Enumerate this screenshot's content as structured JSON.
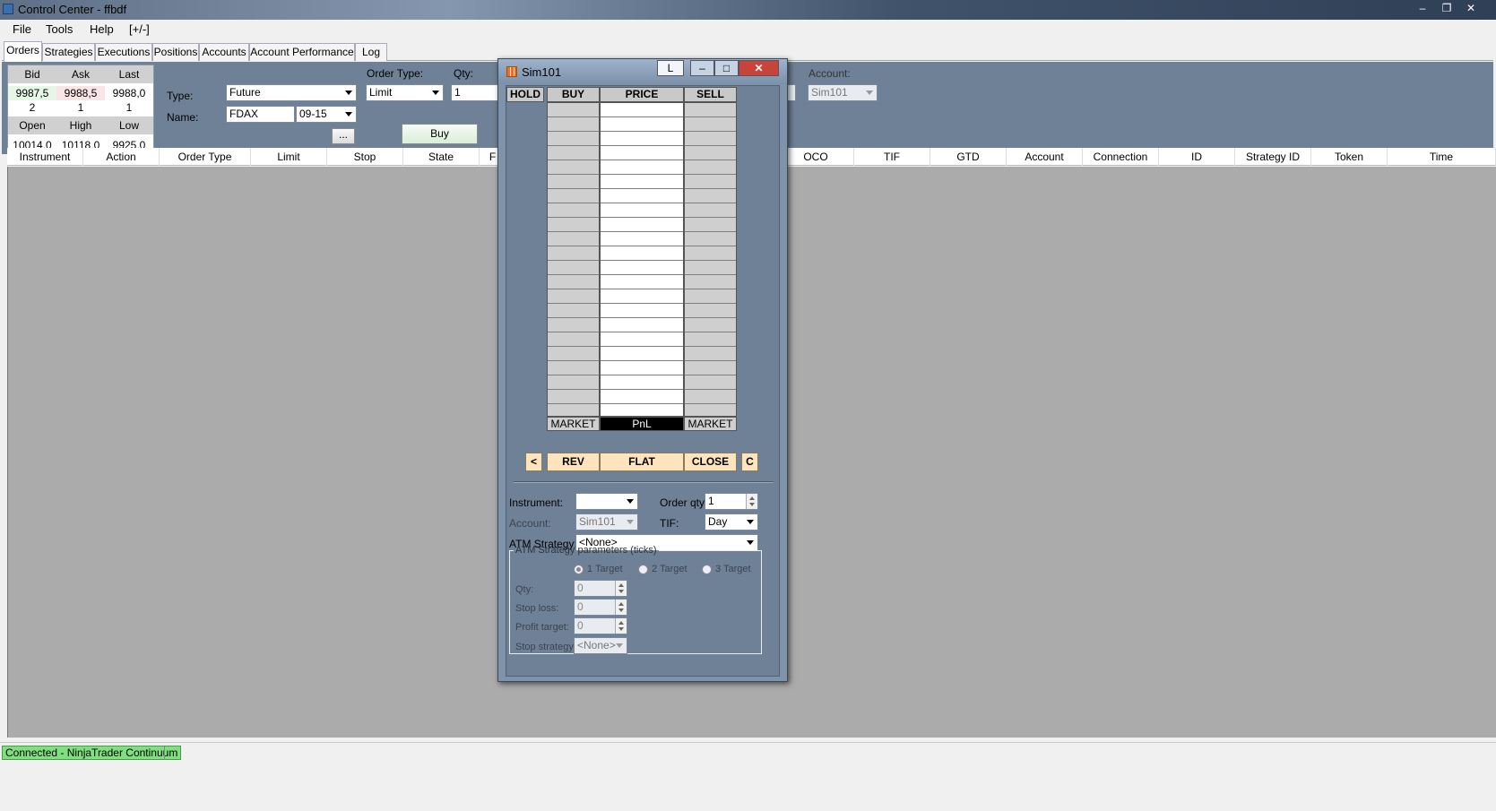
{
  "window": {
    "title": "Control Center - ffbdf"
  },
  "menu": [
    "File",
    "Tools",
    "Help",
    "[+/-]"
  ],
  "tabs": [
    "Orders",
    "Strategies",
    "Executions",
    "Positions",
    "Accounts",
    "Account Performance",
    "Log"
  ],
  "quotes": {
    "headers": [
      "Bid",
      "Ask",
      "Last"
    ],
    "prices": [
      "9987,5",
      "9988,5",
      "9988,0"
    ],
    "sizes": [
      "2",
      "1",
      "1"
    ],
    "ohl_headers": [
      "Open",
      "High",
      "Low"
    ],
    "ohl_values": [
      "10014,0",
      "10118,0",
      "9925,0"
    ]
  },
  "entry": {
    "type_label": "Type:",
    "type_value": "Future",
    "name_label": "Name:",
    "name_value": "FDAX",
    "expiry": "09-15",
    "more_label": "...",
    "order_type_label": "Order Type:",
    "order_type_value": "Limit",
    "qty_label": "Qty:",
    "qty_value": "1",
    "buy_label": "Buy",
    "account_label": "Account:",
    "account_value": "Sim101"
  },
  "grid": {
    "columns": [
      "Instrument",
      "Action",
      "Order Type",
      "Limit",
      "Stop",
      "State",
      "F",
      "OCO",
      "TIF",
      "GTD",
      "Account",
      "Connection",
      "ID",
      "Strategy ID",
      "Token",
      "Time"
    ]
  },
  "status": {
    "text": "Connected - NinjaTrader Continuum"
  },
  "dom": {
    "title": "Sim101",
    "l_button": "L",
    "headers": {
      "hold": "HOLD",
      "buy": "BUY",
      "price": "PRICE",
      "sell": "SELL"
    },
    "footer": {
      "market_buy": "MARKET",
      "pnl": "PnL",
      "market_sell": "MARKET"
    },
    "buttons": {
      "prev": "<",
      "rev": "REV",
      "flat": "FLAT",
      "close": "CLOSE",
      "c": "C"
    },
    "form": {
      "instrument_label": "Instrument:",
      "instrument_value": "",
      "order_qty_label": "Order qty:",
      "order_qty_value": "1",
      "account_label": "Account:",
      "account_value": "Sim101",
      "tif_label": "TIF:",
      "tif_value": "Day",
      "atm_label": "ATM Strategy:",
      "atm_value": "<None>",
      "atm_group": "ATM Strategy parameters (ticks)",
      "targets": [
        "1 Target",
        "2 Target",
        "3 Target"
      ],
      "qty_label": "Qty:",
      "qty_value": "0",
      "stop_loss_label": "Stop loss:",
      "stop_loss_value": "0",
      "profit_target_label": "Profit target:",
      "profit_target_value": "0",
      "stop_strategy_label": "Stop strategy:",
      "stop_strategy_value": "<None>"
    }
  }
}
